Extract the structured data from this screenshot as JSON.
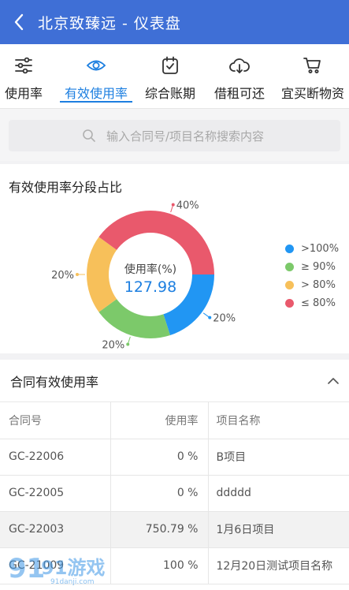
{
  "header": {
    "title": "北京致臻远 - 仪表盘"
  },
  "tabs": [
    {
      "label": "使用率",
      "icon": "sliders-icon"
    },
    {
      "label": "有效使用率",
      "icon": "eye-icon"
    },
    {
      "label": "综合账期",
      "icon": "calendar-check-icon"
    },
    {
      "label": "借租可还",
      "icon": "cloud-download-icon"
    },
    {
      "label": "宜买断物资",
      "icon": "cart-icon"
    }
  ],
  "search": {
    "placeholder": "输入合同号/项目名称搜索内容"
  },
  "donut_card": {
    "title": "有效使用率分段占比"
  },
  "chart_data": {
    "type": "pie",
    "title": "有效使用率分段占比",
    "center_label": "使用率(%)",
    "center_value": "127.98",
    "slices": [
      {
        "name": ">100%",
        "value": 20,
        "label": "20%",
        "color": "#2196f3"
      },
      {
        "name": "≥ 90%",
        "value": 20,
        "label": "20%",
        "color": "#7cc96a"
      },
      {
        "name": "> 80%",
        "value": 20,
        "label": "20%",
        "color": "#f7c05a"
      },
      {
        "name": "≤ 80%",
        "value": 40,
        "label": "40%",
        "color": "#e9596c"
      }
    ],
    "legend_position": "right"
  },
  "table_card": {
    "title": "合同有效使用率",
    "columns": [
      "合同号",
      "使用率",
      "项目名称"
    ],
    "rows": [
      [
        "GC-22006",
        "0 %",
        "B项目"
      ],
      [
        "GC-22005",
        "0 %",
        "ddddd"
      ],
      [
        "GC-22003",
        "750.79 %",
        "1月6日项目"
      ],
      [
        "GC-21009",
        "100 %",
        "12月20日测试项目名称"
      ]
    ]
  },
  "watermark": {
    "text": "91游戏",
    "sub": "91danji.com"
  },
  "colors": {
    "appbar": "#3f6fd6",
    "accent": "#1d7fe0"
  }
}
